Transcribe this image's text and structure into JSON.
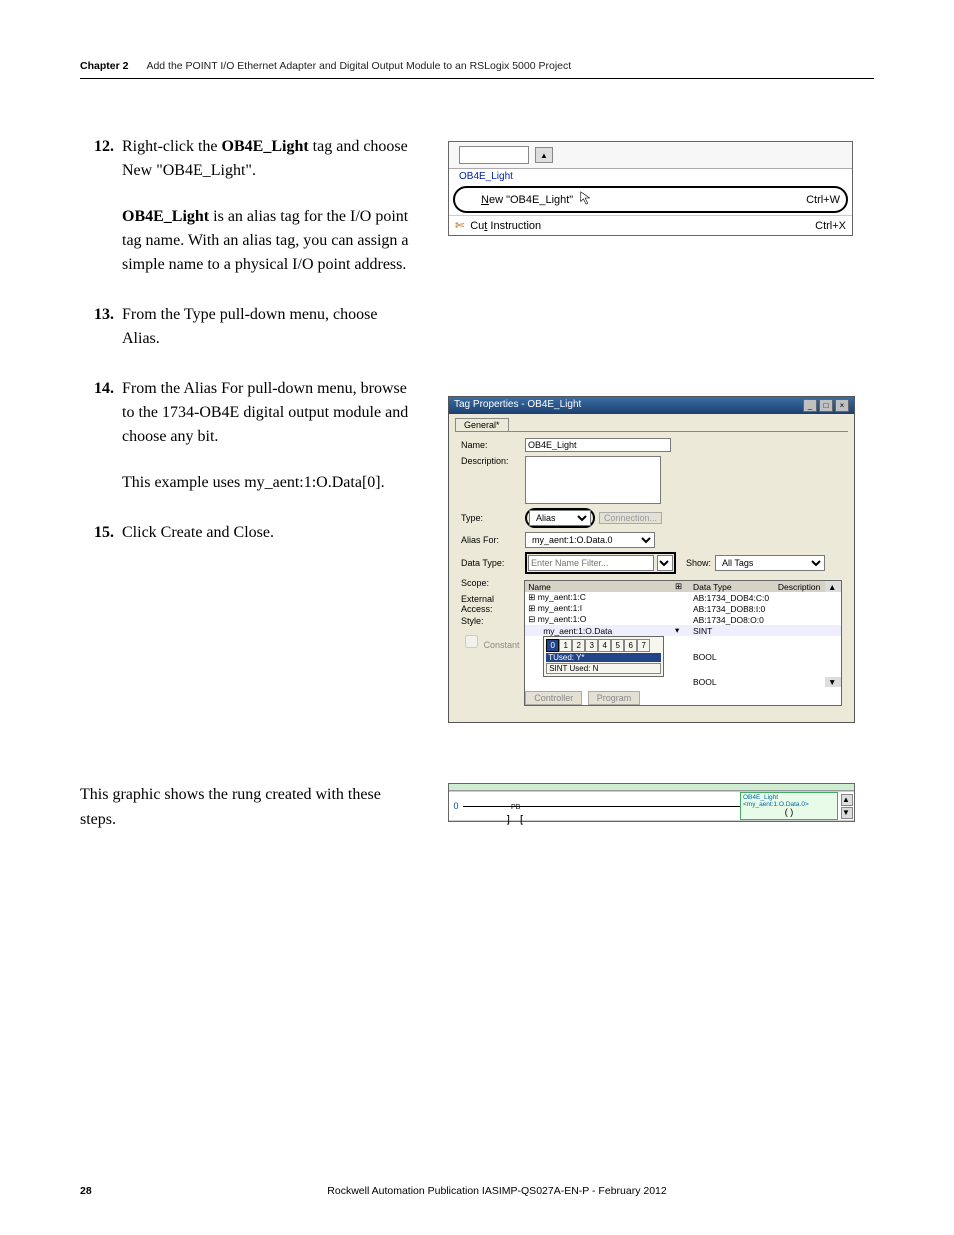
{
  "header": {
    "chapter": "Chapter 2",
    "title": "Add the POINT I/O Ethernet Adapter and Digital Output Module to an RSLogix 5000 Project"
  },
  "steps": {
    "s12": {
      "num": "12.",
      "text_pre": "Right-click the ",
      "bold": "OB4E_Light",
      "text_post": " tag and choose New \"OB4E_Light\".",
      "sub_bold": "OB4E_Light",
      "sub_text": " is an alias tag for the I/O point tag name. With an alias tag, you can assign a simple name to a physical I/O point address."
    },
    "s13": {
      "num": "13.",
      "text": "From the Type pull-down menu, choose Alias."
    },
    "s14": {
      "num": "14.",
      "text": "From the Alias For pull-down menu, browse to the 1734-OB4E digital output module and choose any bit.",
      "sub": "This example uses my_aent:1:O.Data[0]."
    },
    "s15": {
      "num": "15.",
      "text": "Click Create and Close."
    }
  },
  "rung_text": "This graphic shows the rung created with these steps.",
  "scr1": {
    "field_value": "",
    "tag_text": "OB4E_Light",
    "menu_new": "New \"OB4E_Light\"",
    "menu_new_short": "Ctrl+W",
    "menu_cut": "Cut Instruction",
    "menu_cut_short": "Ctrl+X",
    "new_underline": "N",
    "cut_underline": "t"
  },
  "scr2": {
    "title": "Tag Properties - OB4E_Light",
    "tab": "General*",
    "lbl_name": "Name:",
    "name_val": "OB4E_Light",
    "lbl_desc": "Description:",
    "lbl_type": "Type:",
    "type_val": "Alias",
    "type_btn": "Connection...",
    "lbl_alias": "Alias For:",
    "alias_val": "my_aent:1:O.Data.0",
    "lbl_datatype": "Data Type:",
    "dt_filter": "Enter Name Filter...",
    "dt_show": "Show:",
    "dt_show_val": "All Tags",
    "lbl_scope": "Scope:",
    "lbl_ext": "External Access:",
    "lbl_style": "Style:",
    "lbl_const": "Constant",
    "col_name": "Name",
    "col_dt": "Data Type",
    "col_desc": "Description",
    "r1a": "my_aent:1:C",
    "r1b": "AB:1734_DOB4:C:0",
    "r2a": "my_aent:1:I",
    "r2b": "AB:1734_DOB8:I:0",
    "r3a": "my_aent:1:O",
    "r3b": "AB:1734_DO8:O:0",
    "r4a": "my_aent:1:O.Data",
    "r4b": "SINT",
    "bool1": "BOOL",
    "bool2": "BOOL",
    "bp_ty": "TUsed: Y*",
    "bp_sn": "SINT Used: N",
    "btn_ctrl": "Controller",
    "btn_prog": "Program"
  },
  "scr3": {
    "zero": "0",
    "pb": "PB",
    "out_l1": "OB4E_Light",
    "out_l2": "<my_aent:1:O.Data.0>"
  },
  "footer": {
    "page": "28",
    "text": "Rockwell Automation Publication IASIMP-QS027A-EN-P - February 2012"
  }
}
